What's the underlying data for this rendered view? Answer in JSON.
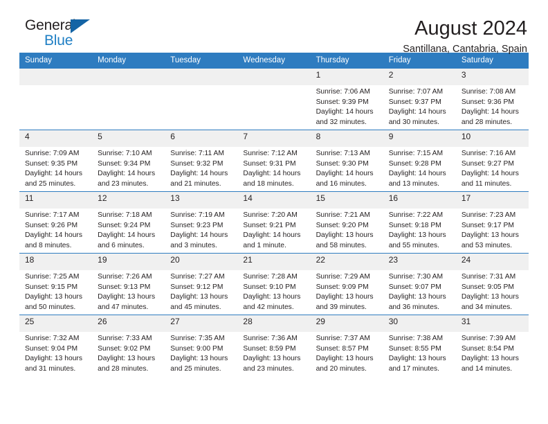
{
  "logo": {
    "word1": "General",
    "word2": "Blue",
    "triangle_color": "#1464a5",
    "blue_color": "#1f7fc4"
  },
  "header": {
    "title": "August 2024",
    "subtitle": "Santillana, Cantabria, Spain"
  },
  "theme": {
    "header_blue": "#2e7cc0",
    "daynum_gray": "#f0f0f0",
    "text": "#231f20"
  },
  "weekdays": [
    "Sunday",
    "Monday",
    "Tuesday",
    "Wednesday",
    "Thursday",
    "Friday",
    "Saturday"
  ],
  "weeks": [
    [
      {
        "day": "",
        "empty": true
      },
      {
        "day": "",
        "empty": true
      },
      {
        "day": "",
        "empty": true
      },
      {
        "day": "",
        "empty": true
      },
      {
        "day": "1",
        "sunrise": "Sunrise: 7:06 AM",
        "sunset": "Sunset: 9:39 PM",
        "daylight": "Daylight: 14 hours and 32 minutes."
      },
      {
        "day": "2",
        "sunrise": "Sunrise: 7:07 AM",
        "sunset": "Sunset: 9:37 PM",
        "daylight": "Daylight: 14 hours and 30 minutes."
      },
      {
        "day": "3",
        "sunrise": "Sunrise: 7:08 AM",
        "sunset": "Sunset: 9:36 PM",
        "daylight": "Daylight: 14 hours and 28 minutes."
      }
    ],
    [
      {
        "day": "4",
        "sunrise": "Sunrise: 7:09 AM",
        "sunset": "Sunset: 9:35 PM",
        "daylight": "Daylight: 14 hours and 25 minutes."
      },
      {
        "day": "5",
        "sunrise": "Sunrise: 7:10 AM",
        "sunset": "Sunset: 9:34 PM",
        "daylight": "Daylight: 14 hours and 23 minutes."
      },
      {
        "day": "6",
        "sunrise": "Sunrise: 7:11 AM",
        "sunset": "Sunset: 9:32 PM",
        "daylight": "Daylight: 14 hours and 21 minutes."
      },
      {
        "day": "7",
        "sunrise": "Sunrise: 7:12 AM",
        "sunset": "Sunset: 9:31 PM",
        "daylight": "Daylight: 14 hours and 18 minutes."
      },
      {
        "day": "8",
        "sunrise": "Sunrise: 7:13 AM",
        "sunset": "Sunset: 9:30 PM",
        "daylight": "Daylight: 14 hours and 16 minutes."
      },
      {
        "day": "9",
        "sunrise": "Sunrise: 7:15 AM",
        "sunset": "Sunset: 9:28 PM",
        "daylight": "Daylight: 14 hours and 13 minutes."
      },
      {
        "day": "10",
        "sunrise": "Sunrise: 7:16 AM",
        "sunset": "Sunset: 9:27 PM",
        "daylight": "Daylight: 14 hours and 11 minutes."
      }
    ],
    [
      {
        "day": "11",
        "sunrise": "Sunrise: 7:17 AM",
        "sunset": "Sunset: 9:26 PM",
        "daylight": "Daylight: 14 hours and 8 minutes."
      },
      {
        "day": "12",
        "sunrise": "Sunrise: 7:18 AM",
        "sunset": "Sunset: 9:24 PM",
        "daylight": "Daylight: 14 hours and 6 minutes."
      },
      {
        "day": "13",
        "sunrise": "Sunrise: 7:19 AM",
        "sunset": "Sunset: 9:23 PM",
        "daylight": "Daylight: 14 hours and 3 minutes."
      },
      {
        "day": "14",
        "sunrise": "Sunrise: 7:20 AM",
        "sunset": "Sunset: 9:21 PM",
        "daylight": "Daylight: 14 hours and 1 minute."
      },
      {
        "day": "15",
        "sunrise": "Sunrise: 7:21 AM",
        "sunset": "Sunset: 9:20 PM",
        "daylight": "Daylight: 13 hours and 58 minutes."
      },
      {
        "day": "16",
        "sunrise": "Sunrise: 7:22 AM",
        "sunset": "Sunset: 9:18 PM",
        "daylight": "Daylight: 13 hours and 55 minutes."
      },
      {
        "day": "17",
        "sunrise": "Sunrise: 7:23 AM",
        "sunset": "Sunset: 9:17 PM",
        "daylight": "Daylight: 13 hours and 53 minutes."
      }
    ],
    [
      {
        "day": "18",
        "sunrise": "Sunrise: 7:25 AM",
        "sunset": "Sunset: 9:15 PM",
        "daylight": "Daylight: 13 hours and 50 minutes."
      },
      {
        "day": "19",
        "sunrise": "Sunrise: 7:26 AM",
        "sunset": "Sunset: 9:13 PM",
        "daylight": "Daylight: 13 hours and 47 minutes."
      },
      {
        "day": "20",
        "sunrise": "Sunrise: 7:27 AM",
        "sunset": "Sunset: 9:12 PM",
        "daylight": "Daylight: 13 hours and 45 minutes."
      },
      {
        "day": "21",
        "sunrise": "Sunrise: 7:28 AM",
        "sunset": "Sunset: 9:10 PM",
        "daylight": "Daylight: 13 hours and 42 minutes."
      },
      {
        "day": "22",
        "sunrise": "Sunrise: 7:29 AM",
        "sunset": "Sunset: 9:09 PM",
        "daylight": "Daylight: 13 hours and 39 minutes."
      },
      {
        "day": "23",
        "sunrise": "Sunrise: 7:30 AM",
        "sunset": "Sunset: 9:07 PM",
        "daylight": "Daylight: 13 hours and 36 minutes."
      },
      {
        "day": "24",
        "sunrise": "Sunrise: 7:31 AM",
        "sunset": "Sunset: 9:05 PM",
        "daylight": "Daylight: 13 hours and 34 minutes."
      }
    ],
    [
      {
        "day": "25",
        "sunrise": "Sunrise: 7:32 AM",
        "sunset": "Sunset: 9:04 PM",
        "daylight": "Daylight: 13 hours and 31 minutes."
      },
      {
        "day": "26",
        "sunrise": "Sunrise: 7:33 AM",
        "sunset": "Sunset: 9:02 PM",
        "daylight": "Daylight: 13 hours and 28 minutes."
      },
      {
        "day": "27",
        "sunrise": "Sunrise: 7:35 AM",
        "sunset": "Sunset: 9:00 PM",
        "daylight": "Daylight: 13 hours and 25 minutes."
      },
      {
        "day": "28",
        "sunrise": "Sunrise: 7:36 AM",
        "sunset": "Sunset: 8:59 PM",
        "daylight": "Daylight: 13 hours and 23 minutes."
      },
      {
        "day": "29",
        "sunrise": "Sunrise: 7:37 AM",
        "sunset": "Sunset: 8:57 PM",
        "daylight": "Daylight: 13 hours and 20 minutes."
      },
      {
        "day": "30",
        "sunrise": "Sunrise: 7:38 AM",
        "sunset": "Sunset: 8:55 PM",
        "daylight": "Daylight: 13 hours and 17 minutes."
      },
      {
        "day": "31",
        "sunrise": "Sunrise: 7:39 AM",
        "sunset": "Sunset: 8:54 PM",
        "daylight": "Daylight: 13 hours and 14 minutes."
      }
    ]
  ]
}
